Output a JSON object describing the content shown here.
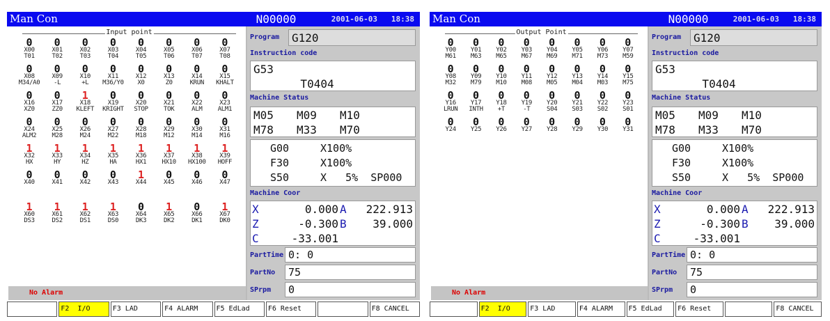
{
  "panels": [
    {
      "mode": "Man Con",
      "block": "N00000",
      "datetime": "2001-06-03   18:38",
      "io_title": "Input point",
      "points": [
        {
          "v": "0",
          "a": "X00",
          "b": "T01"
        },
        {
          "v": "0",
          "a": "X01",
          "b": "T02"
        },
        {
          "v": "0",
          "a": "X02",
          "b": "T03"
        },
        {
          "v": "0",
          "a": "X03",
          "b": "T04"
        },
        {
          "v": "0",
          "a": "X04",
          "b": "T05"
        },
        {
          "v": "0",
          "a": "X05",
          "b": "T06"
        },
        {
          "v": "0",
          "a": "X06",
          "b": "T07"
        },
        {
          "v": "0",
          "a": "X07",
          "b": "T08"
        },
        {
          "v": "0",
          "a": "X08",
          "b": "M34/A0"
        },
        {
          "v": "0",
          "a": "X09",
          "b": "-L"
        },
        {
          "v": "0",
          "a": "X10",
          "b": "+L"
        },
        {
          "v": "0",
          "a": "X11",
          "b": "M36/Y0"
        },
        {
          "v": "0",
          "a": "X12",
          "b": "X0"
        },
        {
          "v": "0",
          "a": "X13",
          "b": "Z0"
        },
        {
          "v": "0",
          "a": "X14",
          "b": "KRUN"
        },
        {
          "v": "0",
          "a": "X15",
          "b": "KHALT"
        },
        {
          "v": "0",
          "a": "X16",
          "b": "XZ0"
        },
        {
          "v": "0",
          "a": "X17",
          "b": "ZZ0"
        },
        {
          "v": "1",
          "a": "X18",
          "b": "KLEFT"
        },
        {
          "v": "0",
          "a": "X19",
          "b": "KRIGHT"
        },
        {
          "v": "0",
          "a": "X20",
          "b": "STOP"
        },
        {
          "v": "0",
          "a": "X21",
          "b": "TOK"
        },
        {
          "v": "0",
          "a": "X22",
          "b": "ALM"
        },
        {
          "v": "0",
          "a": "X23",
          "b": "ALM1"
        },
        {
          "v": "0",
          "a": "X24",
          "b": "ALM2"
        },
        {
          "v": "0",
          "a": "X25",
          "b": "M28"
        },
        {
          "v": "0",
          "a": "X26",
          "b": "M24"
        },
        {
          "v": "0",
          "a": "X27",
          "b": "M22"
        },
        {
          "v": "0",
          "a": "X28",
          "b": "M18"
        },
        {
          "v": "0",
          "a": "X29",
          "b": "M12"
        },
        {
          "v": "0",
          "a": "X30",
          "b": "M14"
        },
        {
          "v": "0",
          "a": "X31",
          "b": "M16"
        },
        {
          "v": "1",
          "a": "X32",
          "b": "HX"
        },
        {
          "v": "1",
          "a": "X33",
          "b": "HY"
        },
        {
          "v": "1",
          "a": "X34",
          "b": "HZ"
        },
        {
          "v": "1",
          "a": "X35",
          "b": "HA"
        },
        {
          "v": "1",
          "a": "X36",
          "b": "HX1"
        },
        {
          "v": "1",
          "a": "X37",
          "b": "HX10"
        },
        {
          "v": "1",
          "a": "X38",
          "b": "HX100"
        },
        {
          "v": "1",
          "a": "X39",
          "b": "HOFF"
        },
        {
          "v": "0",
          "a": "X40",
          "b": ""
        },
        {
          "v": "0",
          "a": "X41",
          "b": ""
        },
        {
          "v": "0",
          "a": "X42",
          "b": ""
        },
        {
          "v": "0",
          "a": "X43",
          "b": ""
        },
        {
          "v": "1",
          "a": "X44",
          "b": ""
        },
        {
          "v": "0",
          "a": "X45",
          "b": ""
        },
        {
          "v": "0",
          "a": "X46",
          "b": ""
        },
        {
          "v": "0",
          "a": "X47",
          "b": ""
        },
        {
          "v": "1",
          "a": "X60",
          "b": "DS3"
        },
        {
          "v": "1",
          "a": "X61",
          "b": "DS2"
        },
        {
          "v": "1",
          "a": "X62",
          "b": "DS1"
        },
        {
          "v": "1",
          "a": "X63",
          "b": "DS0"
        },
        {
          "v": "0",
          "a": "X64",
          "b": "DK3"
        },
        {
          "v": "1",
          "a": "X65",
          "b": "DK2"
        },
        {
          "v": "0",
          "a": "X66",
          "b": "DK1"
        },
        {
          "v": "1",
          "a": "X67",
          "b": "DK0"
        }
      ],
      "alarm": "No Alarm",
      "program_label": "Program",
      "program": "G120",
      "instr_label": "Instruction code",
      "instr1": "G53",
      "instr2": "       T0404",
      "status_label": "Machine Status",
      "mcodes": [
        "M05",
        "M09",
        "M10",
        "M78",
        "M33",
        "M70"
      ],
      "overrides": [
        [
          "G00",
          "X100%"
        ],
        [
          "F30",
          "X100%"
        ],
        [
          "S50",
          "X   5%  SP000"
        ]
      ],
      "coor_label": "Machine Coor",
      "coor": [
        [
          "X",
          "0.000",
          "A",
          "222.913"
        ],
        [
          "Z",
          "-0.300",
          "B",
          "39.000"
        ],
        [
          "C",
          "-33.001",
          "",
          ""
        ]
      ],
      "parttime_label": "PartTime",
      "parttime": "0: 0",
      "partno_label": "PartNo",
      "partno": "75",
      "sprpm_label": "SPrpm",
      "sprpm": "0",
      "fkeys": [
        "",
        "F2  I/O",
        "F3 LAD",
        "F4 ALARM",
        "F5 EdLad",
        "F6 Reset",
        "",
        "F8 CANCEL"
      ],
      "selected_fkey": 1
    },
    {
      "mode": "Man Con",
      "block": "N00000",
      "datetime": "2001-06-03   18:38",
      "io_title": "Output Point",
      "points": [
        {
          "v": "0",
          "a": "Y00",
          "b": "M61"
        },
        {
          "v": "0",
          "a": "Y01",
          "b": "M63"
        },
        {
          "v": "0",
          "a": "Y02",
          "b": "M65"
        },
        {
          "v": "0",
          "a": "Y03",
          "b": "M67"
        },
        {
          "v": "0",
          "a": "Y04",
          "b": "M69"
        },
        {
          "v": "0",
          "a": "Y05",
          "b": "M71"
        },
        {
          "v": "0",
          "a": "Y06",
          "b": "M73"
        },
        {
          "v": "0",
          "a": "Y07",
          "b": "M59"
        },
        {
          "v": "0",
          "a": "Y08",
          "b": "M32"
        },
        {
          "v": "0",
          "a": "Y09",
          "b": "M79"
        },
        {
          "v": "0",
          "a": "Y10",
          "b": "M10"
        },
        {
          "v": "0",
          "a": "Y11",
          "b": "M08"
        },
        {
          "v": "0",
          "a": "Y12",
          "b": "M05"
        },
        {
          "v": "0",
          "a": "Y13",
          "b": "M04"
        },
        {
          "v": "0",
          "a": "Y14",
          "b": "M03"
        },
        {
          "v": "0",
          "a": "Y15",
          "b": "M75"
        },
        {
          "v": "0",
          "a": "Y16",
          "b": "LRUN"
        },
        {
          "v": "0",
          "a": "Y17",
          "b": "INTH"
        },
        {
          "v": "0",
          "a": "Y18",
          "b": "+T"
        },
        {
          "v": "0",
          "a": "Y19",
          "b": "-T"
        },
        {
          "v": "0",
          "a": "Y20",
          "b": "S04"
        },
        {
          "v": "0",
          "a": "Y21",
          "b": "S03"
        },
        {
          "v": "0",
          "a": "Y22",
          "b": "S02"
        },
        {
          "v": "0",
          "a": "Y23",
          "b": "S01"
        },
        {
          "v": "0",
          "a": "Y24",
          "b": ""
        },
        {
          "v": "0",
          "a": "Y25",
          "b": ""
        },
        {
          "v": "0",
          "a": "Y26",
          "b": ""
        },
        {
          "v": "0",
          "a": "Y27",
          "b": ""
        },
        {
          "v": "0",
          "a": "Y28",
          "b": ""
        },
        {
          "v": "0",
          "a": "Y29",
          "b": ""
        },
        {
          "v": "0",
          "a": "Y30",
          "b": ""
        },
        {
          "v": "0",
          "a": "Y31",
          "b": ""
        }
      ],
      "alarm": "No Alarm",
      "program_label": "Program",
      "program": "G120",
      "instr_label": "Instruction code",
      "instr1": "G53",
      "instr2": "       T0404",
      "status_label": "Machine Status",
      "mcodes": [
        "M05",
        "M09",
        "M10",
        "M78",
        "M33",
        "M70"
      ],
      "overrides": [
        [
          "G00",
          "X100%"
        ],
        [
          "F30",
          "X100%"
        ],
        [
          "S50",
          "X   5%  SP000"
        ]
      ],
      "coor_label": "Machine Coor",
      "coor": [
        [
          "X",
          "0.000",
          "A",
          "222.913"
        ],
        [
          "Z",
          "-0.300",
          "B",
          "39.000"
        ],
        [
          "C",
          "-33.001",
          "",
          ""
        ]
      ],
      "parttime_label": "PartTime",
      "parttime": "0: 0",
      "partno_label": "PartNo",
      "partno": "75",
      "sprpm_label": "SPrpm",
      "sprpm": "0",
      "fkeys": [
        "",
        "F2  I/O",
        "F3 LAD",
        "F4 ALARM",
        "F5 EdLad",
        "F6 Reset",
        "",
        "F8 CANCEL"
      ],
      "selected_fkey": 1
    }
  ],
  "colors": {
    "title_bar": "#0a0af0",
    "active_point": "#dd2222",
    "label_blue": "#1a1aa0",
    "selected_fkey": "#ffff00",
    "alarm_text": "#dd0000"
  }
}
